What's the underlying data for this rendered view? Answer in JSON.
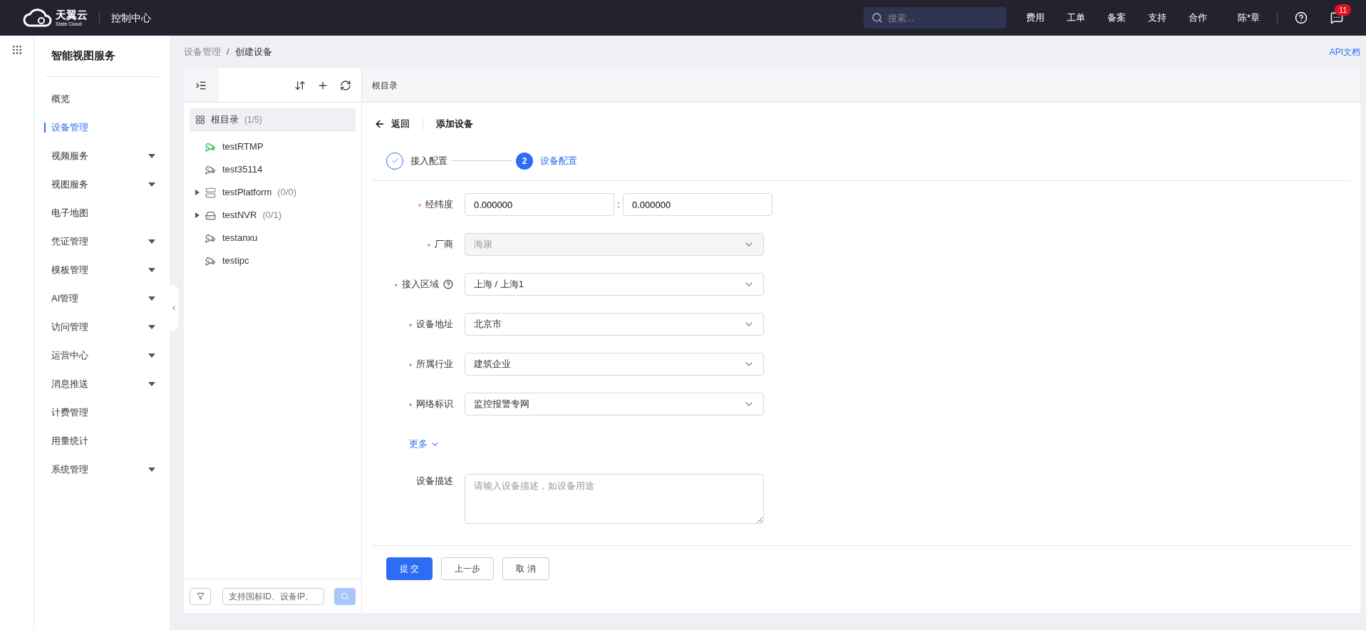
{
  "header": {
    "logo_text": "天翼云",
    "logo_subtext": "State Cloud",
    "console": "控制中心",
    "search": {
      "placeholder": "搜索..."
    },
    "nav": [
      "费用",
      "工单",
      "备案",
      "支持",
      "合作"
    ],
    "user": "陈*章",
    "notification_count": "11"
  },
  "sidebar": {
    "title": "智能视图服务",
    "items": [
      {
        "label": "概览",
        "selected": false,
        "has_submenu": false
      },
      {
        "label": "设备管理",
        "selected": true,
        "has_submenu": false
      },
      {
        "label": "视频服务",
        "selected": false,
        "has_submenu": true
      },
      {
        "label": "视图服务",
        "selected": false,
        "has_submenu": true
      },
      {
        "label": "电子地图",
        "selected": false,
        "has_submenu": false
      },
      {
        "label": "凭证管理",
        "selected": false,
        "has_submenu": true
      },
      {
        "label": "模板管理",
        "selected": false,
        "has_submenu": true
      },
      {
        "label": "AI管理",
        "selected": false,
        "has_submenu": true
      },
      {
        "label": "访问管理",
        "selected": false,
        "has_submenu": true
      },
      {
        "label": "运营中心",
        "selected": false,
        "has_submenu": true
      },
      {
        "label": "消息推送",
        "selected": false,
        "has_submenu": true
      },
      {
        "label": "计费管理",
        "selected": false,
        "has_submenu": false
      },
      {
        "label": "用量统计",
        "selected": false,
        "has_submenu": false
      },
      {
        "label": "系统管理",
        "selected": false,
        "has_submenu": true
      }
    ]
  },
  "breadcrumb_separator": "/",
  "required_mark": "*",
  "breadcrumb": [
    {
      "label": "设备管理",
      "current": false
    },
    {
      "label": "创建设备",
      "current": true
    }
  ],
  "api_link": "API文档",
  "tree": {
    "root": {
      "label": "根目录",
      "count": "(1/5)",
      "selected": true
    },
    "items": [
      {
        "kind": "camera",
        "label": "testRTMP",
        "online": true
      },
      {
        "kind": "camera",
        "label": "test35114",
        "online": false
      },
      {
        "kind": "platform",
        "label": "testPlatform",
        "count": "(0/0)",
        "expanded": false
      },
      {
        "kind": "nvr",
        "label": "testNVR",
        "count": "(0/1)",
        "expanded": false
      },
      {
        "kind": "camera",
        "label": "testanxu",
        "online": false
      },
      {
        "kind": "camera",
        "label": "testipc",
        "online": false
      }
    ],
    "search": {
      "placeholder": "支持国标ID、设备IP、"
    }
  },
  "panel_title": "根目录",
  "back": "返回",
  "title": "添加设备",
  "steps": [
    {
      "label": "接入配置",
      "done": true,
      "selected": false
    },
    {
      "label": "设备配置",
      "number": "2",
      "done": false,
      "selected": true
    }
  ],
  "fields": [
    {
      "kind": "coords",
      "label": "经纬度",
      "required": true,
      "values": [
        "0.000000",
        "0.000000"
      ],
      "separator": ":"
    },
    {
      "kind": "select",
      "label": "厂商",
      "required": true,
      "value": "海康",
      "disabled": true
    },
    {
      "kind": "select",
      "label": "接入区域",
      "required": true,
      "value": "上海 / 上海1",
      "disabled": false,
      "help": true
    },
    {
      "kind": "select",
      "label": "设备地址",
      "required": true,
      "value": "北京市",
      "disabled": false
    },
    {
      "kind": "select",
      "label": "所属行业",
      "required": true,
      "value": "建筑企业",
      "disabled": false
    },
    {
      "kind": "select",
      "label": "网络标识",
      "required": true,
      "value": "监控报警专网",
      "disabled": false
    },
    {
      "kind": "more",
      "label": "更多"
    },
    {
      "kind": "textarea",
      "label": "设备描述",
      "required": false,
      "placeholder": "请输入设备描述，如设备用途"
    }
  ],
  "buttons": [
    {
      "label": "提 交",
      "kind": "primary"
    },
    {
      "label": "上一步",
      "kind": "default"
    },
    {
      "label": "取 消",
      "kind": "default"
    }
  ]
}
